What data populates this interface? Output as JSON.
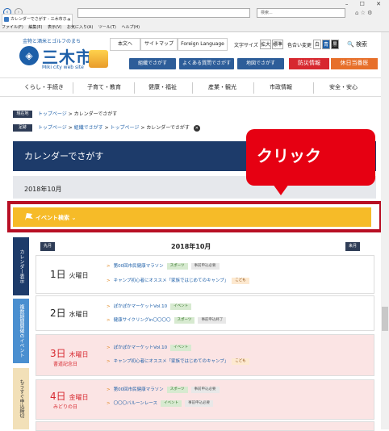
{
  "browser": {
    "tab_title": "カレンダーでさがす - 三木市ホ…",
    "search_placeholder": "検索...",
    "menu": [
      "ファイル(F)",
      "編集(E)",
      "表示(V)",
      "お気に入り(A)",
      "ツール(T)",
      "ヘルプ(H)"
    ],
    "back_icon": "back-arrow-icon",
    "forward_icon": "forward-arrow-icon"
  },
  "header": {
    "logo_catch": "金物と酒米とゴルフのまち",
    "logo_main": "三木市",
    "logo_en": "Miki city web site",
    "top_links": [
      "本文へ",
      "サイトマップ",
      "Foreign Language"
    ],
    "font_size_label": "文字サイズ",
    "font_size_btns": [
      "拡大",
      "標準"
    ],
    "color_label": "色合い変更",
    "color_btns": [
      "白",
      "青",
      "黒"
    ],
    "search_label": "検索",
    "find_buttons": [
      "組織でさがす",
      "よくある質問でさがす",
      "地図でさがす"
    ],
    "emergency_btn": "防災情報",
    "holiday_btn": "休日当番医",
    "accent": "#1d5fa8"
  },
  "mainnav": [
    "くらし・手続き",
    "子育て・教育",
    "健康・福祉",
    "産業・観光",
    "市政情報",
    "安全・安心"
  ],
  "breadcrumb": {
    "current_label": "現在地",
    "current": [
      "トップページ",
      "カレンダーでさがす"
    ],
    "history_label": "足跡",
    "history": [
      "トップページ",
      "組織でさがす",
      "トップページ",
      "カレンダーでさがす"
    ]
  },
  "page_title": "カレンダーでさがす",
  "month_label": "2018年10月",
  "callout": "クリック",
  "event_search": "イベント検索",
  "side_tabs": [
    "カレンダー表示",
    "複数期間開催のイベント",
    "もうすぐ申込締切"
  ],
  "calendar": {
    "prev": "先月",
    "next": "来月",
    "title": "2018年10月",
    "days": [
      {
        "num": "1日",
        "dow": "火曜日",
        "note": "",
        "events": [
          {
            "title": "第00回市民健康マラソン",
            "tags": [
              "スポーツ",
              "事前申込必要"
            ]
          },
          {
            "title": "キャンプ初心者にオススメ「家族ではじめてのキャンプ」",
            "tags": [
              "こども"
            ]
          }
        ]
      },
      {
        "num": "2日",
        "dow": "水曜日",
        "note": "",
        "events": [
          {
            "title": "ぽかぽかマーケットVol.10",
            "tags": [
              "イベント"
            ]
          },
          {
            "title": "健康サイクリングin〇〇〇〇",
            "tags": [
              "スポーツ",
              "事前申込終了"
            ]
          }
        ]
      },
      {
        "num": "3日",
        "dow": "木曜日",
        "note": "書道記念日",
        "events": [
          {
            "title": "ぽかぽかマーケットVol.10",
            "tags": [
              "イベント"
            ]
          },
          {
            "title": "キャンプ初心者にオススメ「家族ではじめてのキャンプ」",
            "tags": [
              "こども"
            ]
          }
        ]
      },
      {
        "num": "4日",
        "dow": "金曜日",
        "note": "みどりの日",
        "events": [
          {
            "title": "第00回市民健康マラソン",
            "tags": [
              "スポーツ",
              "事前申込必要"
            ]
          },
          {
            "title": "〇〇〇バルーンレース",
            "tags": [
              "イベント",
              "事前申込必要"
            ]
          }
        ]
      }
    ]
  }
}
